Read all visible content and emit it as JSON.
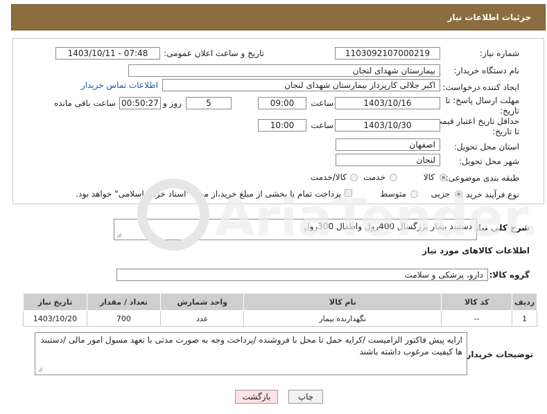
{
  "header": {
    "title": "جزئیات اطلاعات نیاز"
  },
  "form": {
    "need_number": {
      "label": "شماره نیاز:",
      "value": "1103092107000219"
    },
    "announce_date": {
      "label": "تاریخ و ساعت اعلان عمومی:",
      "value": "1403/10/11 - 07:48"
    },
    "buyer_org": {
      "label": "نام دستگاه خریدار:",
      "value": "بیمارستان شهدای لنجان"
    },
    "requester": {
      "label": "ایجاد کننده درخواست:",
      "value": "اکبر جلالی کارپرداز بیمارستان شهدای لنجان",
      "contact_link": "اطلاعات تماس خریدار"
    },
    "deadline": {
      "label": "مهلت ارسال پاسخ: تا تاریخ:",
      "date": "1403/10/16",
      "time_label": "ساعت",
      "time": "09:00",
      "days": "5",
      "days_label": "روز و",
      "remaining": "00:50:27",
      "remaining_label": "ساعت باقی مانده"
    },
    "price_validity": {
      "label": "حداقل تاریخ اعتبار قیمت: تا تاریخ:",
      "date": "1403/10/30",
      "time_label": "ساعت",
      "time": "10:00"
    },
    "province": {
      "label": "استان محل تحویل:",
      "value": "اصفهان"
    },
    "city": {
      "label": "شهر محل تحویل:",
      "value": "لنجان"
    },
    "category": {
      "label": "طبقه بندی موضوعی:",
      "options": [
        "کالا",
        "خدمت",
        "کالا/خدمت"
      ],
      "selected": "کالا"
    },
    "purchase_type": {
      "label": "نوع فرآیند خرید :",
      "options": [
        "جزیی",
        "متوسط"
      ],
      "selected": "جزیی",
      "payment_note": "پرداخت تمام یا بخشی از مبلغ خرید،از محل \"اسناد خزانه اسلامی\" خواهد بود."
    }
  },
  "description": {
    "label": "شرح کلی نیاز:",
    "value": "دستبند بیمار بزرگسال 400رول واطفال 300رول"
  },
  "goods_info": {
    "section_title": "اطلاعات کالاهای مورد نیاز",
    "group_label": "گروه کالا:",
    "group_value": "دارو، پزشکی و سلامت",
    "table": {
      "headers": [
        "ردیف",
        "کد کالا",
        "نام کالا",
        "واحد شمارش",
        "تعداد / مقدار",
        "تاریخ نیاز"
      ],
      "rows": [
        {
          "row": "1",
          "code": "--",
          "name": "نگهدارنده بیمار",
          "unit": "عدد",
          "qty": "700",
          "date": "1403/10/20"
        }
      ]
    }
  },
  "buyer_notes": {
    "label": "توضیحات خریدار:",
    "value": "ارایه پیش فاکتور الزامیست /کرایه حمل تا محل با فروشنده /پرداخت وجه به صورت مدتی با تعهد مسول امور مالی /دستبند ها کیفیت مرغوب داشته باشند"
  },
  "buttons": {
    "print": "چاپ",
    "back": "بازگشت"
  },
  "watermark": {
    "text": "AriaTender.neT"
  },
  "colors": {
    "header_bg": "#8b6d3f",
    "link": "#1a57b3",
    "back_button_bg": "#fde3e3"
  }
}
